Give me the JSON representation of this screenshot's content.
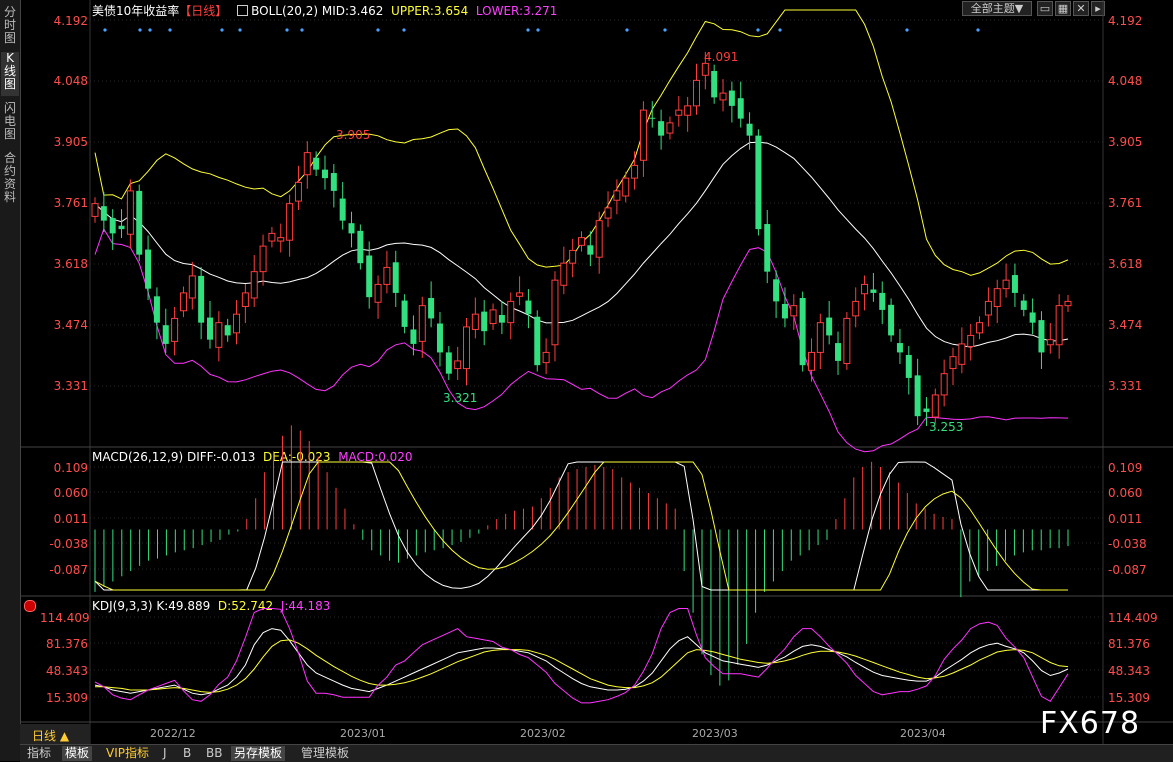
{
  "sidebar": {
    "tabs": [
      {
        "label": "分时图"
      },
      {
        "label": "K线图",
        "active": true
      },
      {
        "label": "闪电图"
      },
      {
        "label": "合约资料"
      }
    ]
  },
  "header": {
    "title": "美债10年收益率",
    "period_tag": "【日线】",
    "boll_name": "BOLL(20,2)",
    "mid": "MID:3.462",
    "upper": "UPPER:3.654",
    "lower": "LOWER:3.271",
    "theme_select": "全部主题▼"
  },
  "main_axis": {
    "ticks": [
      "4.192",
      "4.048",
      "3.905",
      "3.761",
      "3.618",
      "3.474",
      "3.331"
    ]
  },
  "annotations": {
    "high1": "3.905",
    "high2": "4.091",
    "low1": "3.321",
    "low2": "3.253"
  },
  "macd": {
    "name": "MACD(26,12,9)",
    "diff": "DIFF:-0.013",
    "dea": "DEA:-0.023",
    "macd": "MACD:0.020",
    "ticks": [
      "0.109",
      "0.060",
      "0.011",
      "-0.038",
      "-0.087"
    ]
  },
  "kdj": {
    "name": "KDJ(9,3,3)",
    "k": "K:49.889",
    "d": "D:52.742",
    "j": "J:44.183",
    "ticks": [
      "114.409",
      "81.376",
      "48.343",
      "15.309"
    ]
  },
  "x_axis": {
    "period_label": "日线 ▲",
    "labels": [
      "2022/12",
      "2023/01",
      "2023/02",
      "2023/03",
      "2023/04"
    ]
  },
  "bottom_tabs": [
    {
      "label": "指标"
    },
    {
      "label": "模板",
      "active": true
    },
    {
      "label": "VIP指标"
    },
    {
      "label": "J"
    },
    {
      "label": "B"
    },
    {
      "label": "BB"
    },
    {
      "label": "另存模板",
      "active": true
    },
    {
      "label": "管理模板"
    }
  ],
  "watermark": "FX678",
  "colors": {
    "up": "#ff3d3d",
    "down": "#33e07f",
    "mid_line": "#ffffff",
    "upper_line": "#ffff33",
    "lower_line": "#ff33ff",
    "axis_text": "#ff4d4d",
    "macd_diff": "#ffffff",
    "macd_dea": "#ffff33",
    "kdj_j": "#ff33ff"
  },
  "chart_data": [
    {
      "type": "candlestick",
      "title": "美债10年收益率",
      "ylim": [
        3.19,
        4.21
      ],
      "values_close": [
        3.76,
        3.72,
        3.69,
        3.7,
        3.79,
        3.64,
        3.56,
        3.48,
        3.43,
        3.49,
        3.55,
        3.59,
        3.48,
        3.44,
        3.48,
        3.45,
        3.5,
        3.55,
        3.6,
        3.66,
        3.69,
        3.68,
        3.76,
        3.81,
        3.88,
        3.84,
        3.82,
        3.79,
        3.72,
        3.69,
        3.62,
        3.54,
        3.57,
        3.61,
        3.55,
        3.47,
        3.43,
        3.52,
        3.49,
        3.41,
        3.36,
        3.39,
        3.47,
        3.5,
        3.46,
        3.51,
        3.48,
        3.53,
        3.55,
        3.5,
        3.38,
        3.41,
        3.58,
        3.62,
        3.65,
        3.68,
        3.64,
        3.72,
        3.75,
        3.79,
        3.82,
        3.85,
        3.98,
        3.96,
        3.92,
        3.95,
        3.98,
        3.99,
        4.05,
        4.09,
        4.01,
        4.02,
        3.99,
        3.96,
        3.92,
        3.7,
        3.6,
        3.53,
        3.49,
        3.52,
        3.38,
        3.41,
        3.48,
        3.45,
        3.39,
        3.49,
        3.53,
        3.57,
        3.55,
        3.51,
        3.45,
        3.41,
        3.35,
        3.26,
        3.27,
        3.31,
        3.36,
        3.4,
        3.43,
        3.45,
        3.48,
        3.53,
        3.56,
        3.58,
        3.55,
        3.51,
        3.48,
        3.41,
        3.44,
        3.52,
        3.53
      ]
    },
    {
      "type": "bar",
      "title": "MACD(26,12,9)",
      "ylim": [
        -0.16,
        0.12
      ],
      "values": [
        -0.06,
        -0.055,
        -0.05,
        -0.045,
        -0.04,
        -0.035,
        -0.03,
        -0.028,
        -0.025,
        -0.022,
        -0.02,
        -0.018,
        -0.015,
        -0.012,
        -0.01,
        -0.005,
        -0.002,
        0.01,
        0.03,
        0.055,
        0.075,
        0.09,
        0.1,
        0.095,
        0.085,
        0.07,
        0.055,
        0.04,
        0.02,
        0.005,
        -0.01,
        -0.02,
        -0.025,
        -0.03,
        -0.032,
        -0.028,
        -0.025,
        -0.022,
        -0.02,
        -0.018,
        -0.015,
        -0.012,
        -0.008,
        -0.004,
        0.004,
        0.01,
        0.015,
        0.018,
        0.02,
        0.022,
        0.03,
        0.04,
        0.05,
        0.055,
        0.058,
        0.06,
        0.062,
        0.06,
        0.058,
        0.05,
        0.045,
        0.04,
        0.035,
        0.03,
        0.025,
        0.02,
        -0.04,
        -0.08,
        -0.12,
        -0.14,
        -0.15,
        -0.145,
        -0.13,
        -0.11,
        -0.08,
        -0.06,
        -0.05,
        -0.04,
        -0.03,
        -0.025,
        -0.02,
        -0.015,
        -0.01,
        0.01,
        0.03,
        0.05,
        0.06,
        0.065,
        0.06,
        0.055,
        0.045,
        0.035,
        0.025,
        0.02,
        0.015,
        0.012,
        0.01,
        -0.065,
        -0.05,
        -0.045,
        -0.04,
        -0.035,
        -0.03,
        -0.025,
        -0.022,
        -0.02,
        -0.02,
        -0.018,
        -0.018,
        -0.016
      ]
    },
    {
      "type": "line",
      "title": "KDJ(9,3,3)",
      "ylim": [
        0,
        125
      ],
      "series": [
        {
          "name": "K",
          "values": [
            30,
            28,
            24,
            22,
            20,
            22,
            24,
            26,
            28,
            30,
            25,
            20,
            18,
            20,
            25,
            30,
            40,
            55,
            80,
            95,
            100,
            98,
            85,
            70,
            55,
            45,
            40,
            35,
            30,
            26,
            24,
            22,
            26,
            30,
            35,
            40,
            45,
            50,
            55,
            60,
            65,
            70,
            72,
            74,
            76,
            76,
            75,
            74,
            72,
            70,
            65,
            60,
            52,
            45,
            38,
            32,
            28,
            26,
            24,
            24,
            25,
            28,
            35,
            45,
            60,
            75,
            85,
            90,
            80,
            70,
            65,
            60,
            58,
            56,
            54,
            52,
            55,
            60,
            65,
            72,
            78,
            80,
            78,
            74,
            70,
            65,
            58,
            52,
            46,
            42,
            40,
            38,
            36,
            35,
            35,
            40,
            48,
            55,
            62,
            70,
            76,
            80,
            82,
            78,
            75,
            70,
            60,
            48,
            42,
            45,
            50
          ]
        },
        {
          "name": "D",
          "values": [
            28,
            28,
            27,
            26,
            24,
            24,
            24,
            25,
            26,
            27,
            26,
            24,
            22,
            21,
            22,
            25,
            30,
            38,
            50,
            65,
            78,
            85,
            86,
            82,
            75,
            67,
            60,
            53,
            47,
            41,
            36,
            32,
            30,
            30,
            31,
            33,
            36,
            40,
            44,
            49,
            54,
            59,
            63,
            67,
            71,
            73,
            74,
            74,
            74,
            73,
            70,
            67,
            62,
            56,
            50,
            44,
            38,
            34,
            30,
            28,
            27,
            27,
            29,
            33,
            40,
            50,
            60,
            70,
            74,
            73,
            71,
            68,
            65,
            62,
            60,
            58,
            57,
            58,
            60,
            63,
            67,
            70,
            72,
            72,
            71,
            69,
            66,
            62,
            58,
            54,
            50,
            46,
            43,
            40,
            38,
            39,
            41,
            45,
            50,
            55,
            61,
            66,
            71,
            73,
            74,
            73,
            70,
            64,
            58,
            54,
            53
          ]
        },
        {
          "name": "J",
          "values": [
            34,
            28,
            18,
            14,
            12,
            18,
            24,
            28,
            32,
            36,
            23,
            12,
            10,
            18,
            31,
            40,
            60,
            89,
            120,
            125,
            125,
            124,
            100,
            70,
            35,
            20,
            20,
            18,
            15,
            15,
            15,
            15,
            30,
            40,
            55,
            60,
            70,
            80,
            85,
            90,
            95,
            100,
            90,
            88,
            86,
            84,
            77,
            74,
            68,
            64,
            55,
            46,
            32,
            23,
            14,
            8,
            8,
            10,
            12,
            16,
            21,
            30,
            47,
            69,
            100,
            120,
            125,
            125,
            92,
            64,
            53,
            44,
            44,
            44,
            42,
            40,
            51,
            64,
            75,
            90,
            100,
            100,
            90,
            78,
            68,
            57,
            42,
            32,
            22,
            18,
            20,
            22,
            22,
            25,
            29,
            42,
            62,
            75,
            86,
            100,
            106,
            108,
            104,
            88,
            77,
            64,
            40,
            16,
            10,
            27,
            44
          ]
        }
      ]
    }
  ]
}
